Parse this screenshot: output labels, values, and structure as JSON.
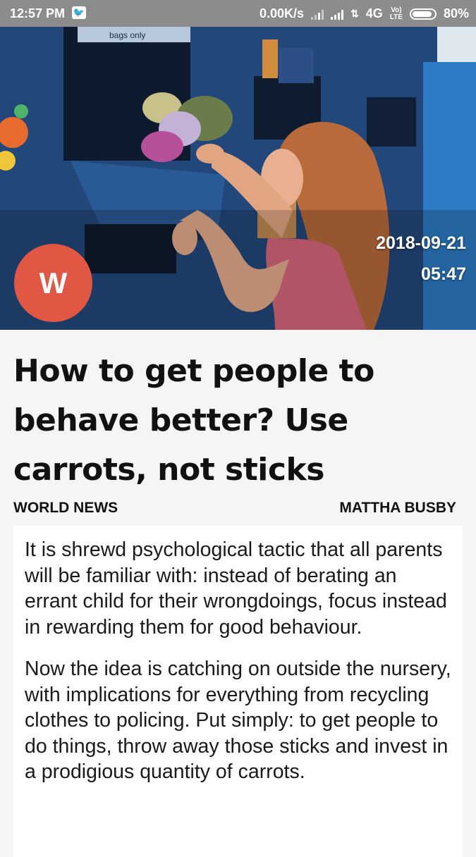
{
  "status_bar": {
    "time": "12:57 PM",
    "net_speed": "0.00K/s",
    "network_type": "4G",
    "volte": "Vo)) LTE",
    "battery": "80%",
    "notification_icon": "twitter-icon"
  },
  "article": {
    "source_initial": "W",
    "date": "2018-09-21",
    "time": "05:47",
    "title": "How to get people to behave better? Use carrots, not sticks",
    "category": "WORLD NEWS",
    "author": "MATTHA BUSBY",
    "paragraphs": [
      "It is shrewd psychological tactic that all parents will be familiar with: instead of berating an errant child for their wrongdoings, focus instead in rewarding them for good behaviour.",
      "Now the idea is catching on outside the nursery, with implications for everything from recycling clothes to policing. Put simply: to get people to do things, throw away those sticks and invest in a prodigious quantity of carrots."
    ]
  },
  "hero_image": {
    "bin_text": "bags only"
  },
  "colors": {
    "status_bar": "#8c8c8c",
    "avatar": "#e15744",
    "page_background": "#f5f5f5"
  }
}
